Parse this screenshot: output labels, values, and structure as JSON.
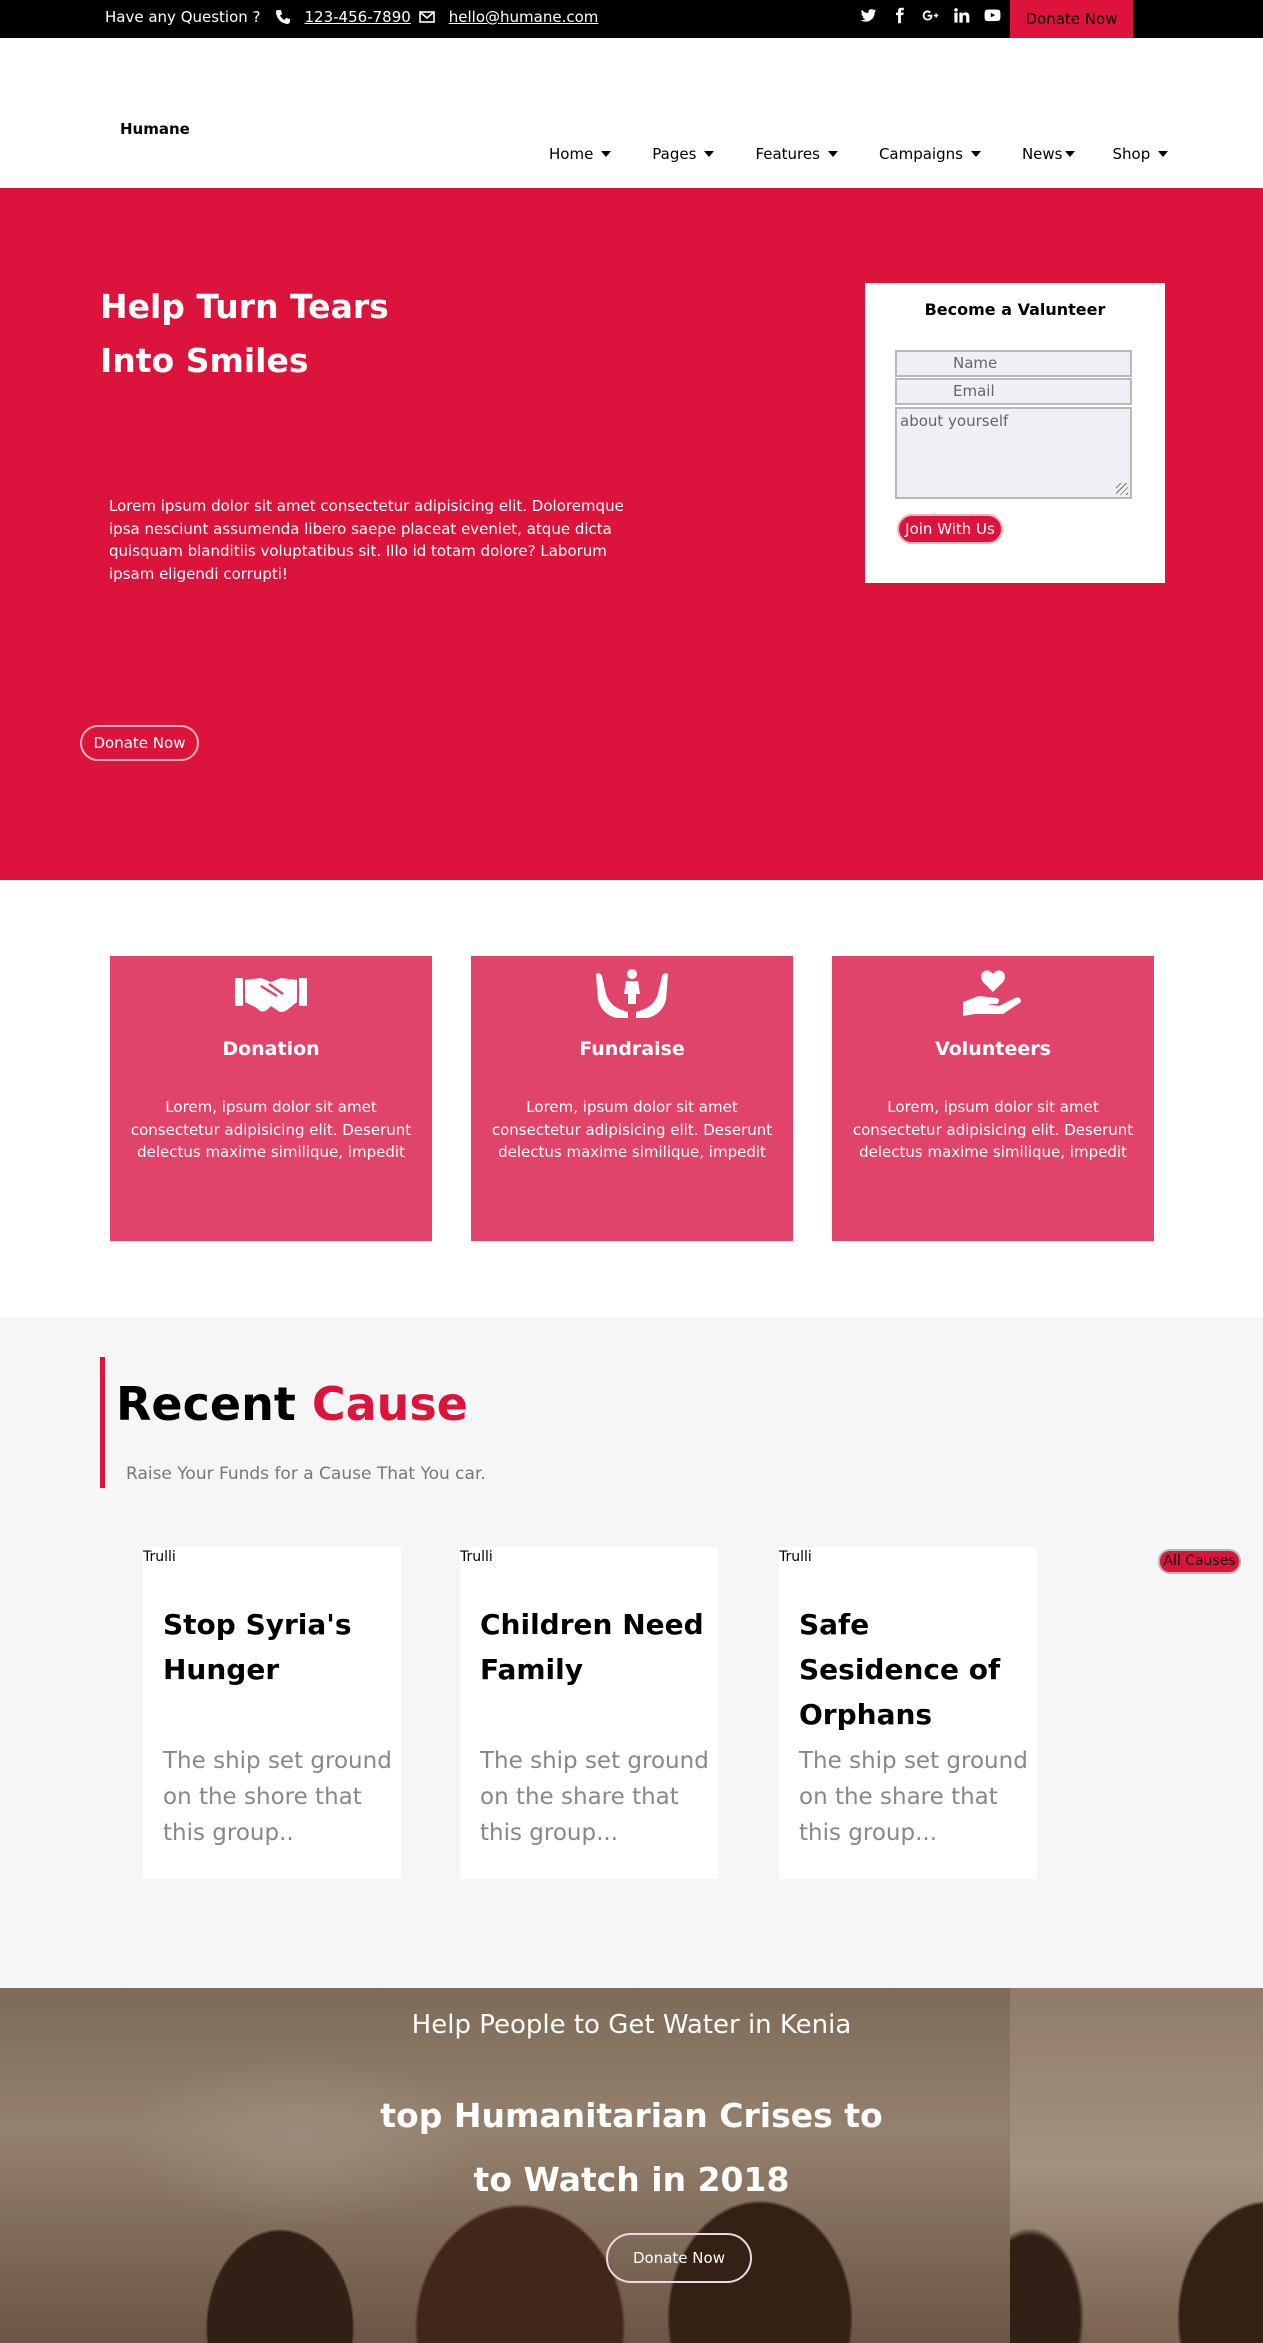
{
  "topbar": {
    "question": "Have any Question ?",
    "phone": "123-456-7890",
    "email": "hello@humane.com",
    "social_icons": [
      "twitter-icon",
      "facebook-icon",
      "google-plus-icon",
      "linkedin-icon",
      "youtube-icon"
    ],
    "donate_label": "Donate Now"
  },
  "header": {
    "logo": "Humane",
    "nav": [
      {
        "label": "Home"
      },
      {
        "label": "Pages"
      },
      {
        "label": "Features"
      },
      {
        "label": "Campaigns"
      },
      {
        "label": "News"
      },
      {
        "label": "Shop"
      }
    ]
  },
  "hero": {
    "title_line1": "Help Turn Tears",
    "title_line2": "Into Smiles",
    "text": "Lorem ipsum dolor sit amet consectetur adipisicing elit. Doloremque ipsa nesciunt assumenda libero saepe placeat eveniet, atque dicta quisquam blanditiis voluptatibus sit. Illo id totam dolore? Laborum ipsam eligendi corrupti!",
    "donate_label": "Donate Now",
    "volunteer": {
      "title": "Become a Valunteer",
      "name_placeholder": "Name",
      "email_placeholder": "Email",
      "about_placeholder": "about yourself",
      "join_label": "Join With Us"
    }
  },
  "features": [
    {
      "icon": "handshake-icon",
      "title": "Donation",
      "text": "Lorem, ipsum dolor sit amet consectetur adipisicing elit. Deserunt delectus maxime similique, impedit"
    },
    {
      "icon": "hands-child-icon",
      "title": "Fundraise",
      "text": "Lorem, ipsum dolor sit amet consectetur adipisicing elit. Deserunt delectus maxime similique, impedit"
    },
    {
      "icon": "hand-heart-icon",
      "title": "Volunteers",
      "text": "Lorem, ipsum dolor sit amet consectetur adipisicing elit. Deserunt delectus maxime similique, impedit"
    }
  ],
  "causes": {
    "heading_black": "Recent",
    "heading_red": "Cause",
    "subtitle": "Raise Your Funds for a Cause That You car.",
    "all_label": "All Causes",
    "items": [
      {
        "img_alt": "Trulli",
        "title": "Stop Syria's Hunger",
        "desc": "The ship set ground on the shore that this group.."
      },
      {
        "img_alt": "Trulli",
        "title": "Children Need Family",
        "desc": "The ship set ground on the share that this group..."
      },
      {
        "img_alt": "Trulli",
        "title": "Safe Sesidence of Orphans",
        "desc": "The ship set ground on the share that this group..."
      }
    ]
  },
  "banner": {
    "subtitle": "Help People to Get Water in Kenia",
    "title_line1": "top Humanitarian Crises to",
    "title_line2": "to Watch in 2018",
    "donate_label": "Donate Now"
  },
  "colors": {
    "accent": "#dc143c",
    "card": "#e0446b",
    "topbar": "#000000",
    "section_bg": "#f6f6f6"
  }
}
